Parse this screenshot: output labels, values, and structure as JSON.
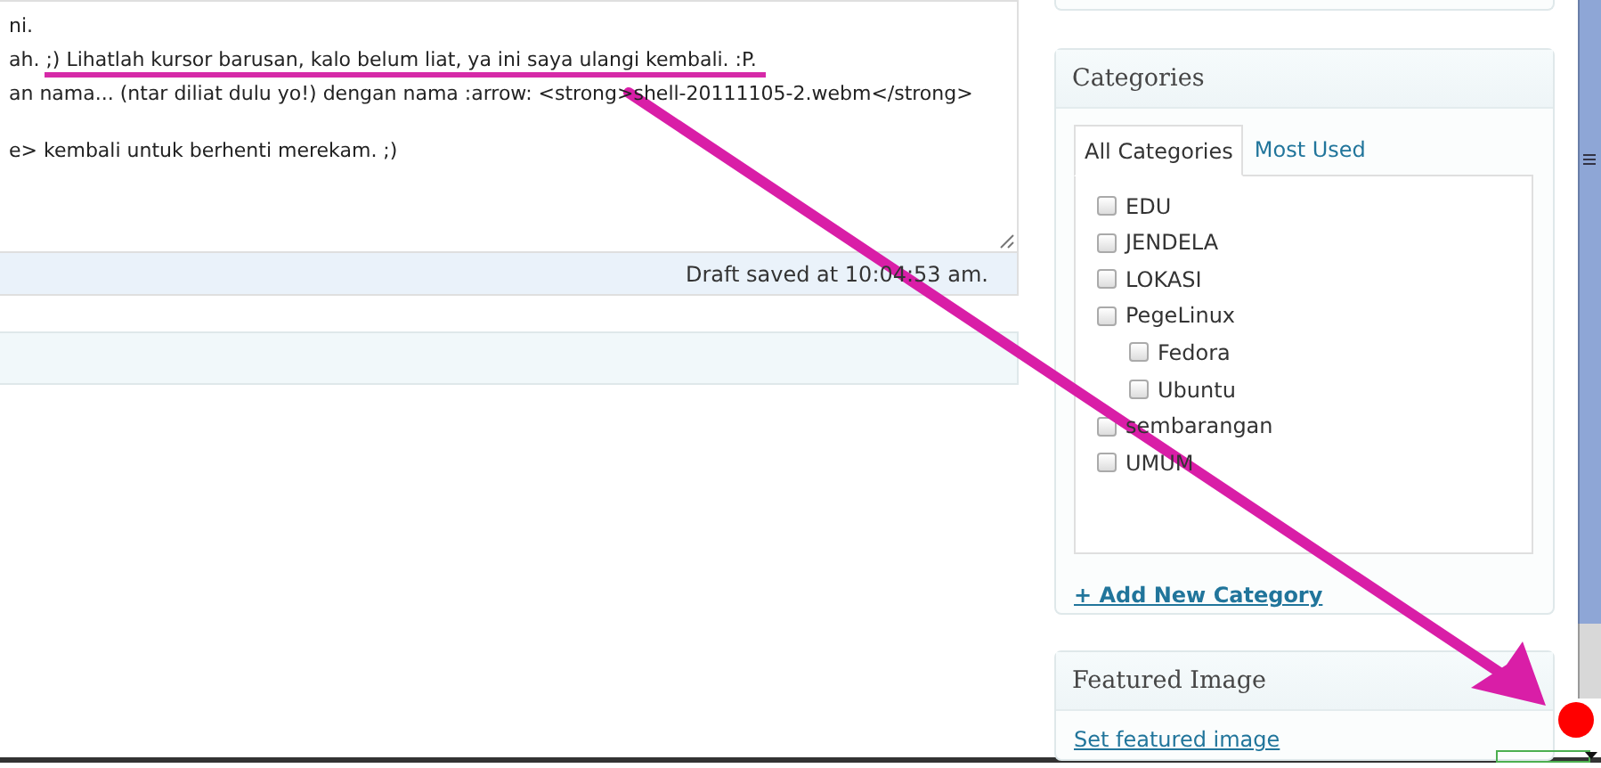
{
  "editor": {
    "paragraphs": [
      [
        "ni.",
        "ah. ;) Lihatlah kursor barusan, kalo belum liat, ya ini saya ulangi kembali. :P.",
        "an nama... (ntar diliat dulu yo!) dengan nama :arrow: <strong>shell-20111105-2.webm</strong>"
      ],
      [
        "e> kembali untuk berhenti merekam. ;)"
      ]
    ],
    "status": "Draft saved at 10:04:53 am."
  },
  "categories": {
    "title": "Categories",
    "tabs": [
      {
        "label": "All Categories",
        "selected": true
      },
      {
        "label": "Most Used",
        "selected": false
      }
    ],
    "items": [
      {
        "label": "EDU",
        "checked": false
      },
      {
        "label": "JENDELA",
        "checked": false
      },
      {
        "label": "LOKASI",
        "checked": false
      },
      {
        "label": "PegeLinux",
        "checked": false,
        "children": [
          {
            "label": "Fedora",
            "checked": false
          },
          {
            "label": "Ubuntu",
            "checked": false
          }
        ]
      },
      {
        "label": "sembarangan",
        "checked": false
      },
      {
        "label": "UMUM",
        "checked": false
      }
    ],
    "add_link": "+ Add New Category"
  },
  "featured_image": {
    "title": "Featured Image",
    "link": "Set featured image"
  }
}
